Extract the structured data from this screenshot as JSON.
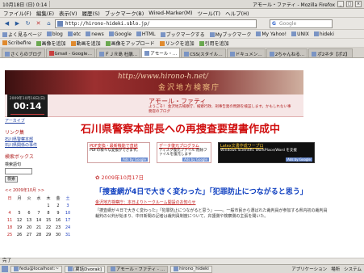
{
  "top_panel": {
    "date_time": "10月18日 (日)  0:14",
    "window_title": "アモール・ファティ - Mozilla Firefox"
  },
  "menu": [
    "ファイル(F)",
    "編集(E)",
    "表示(V)",
    "履歴(S)",
    "ブックマーク(B)",
    "Wired-Marker(M)",
    "ツール(T)",
    "ヘルプ(H)"
  ],
  "nav": {
    "url": "http://hirono-hideki.sblo.jp/",
    "search_placeholder": "Google"
  },
  "bookmarks": [
    "よく見るページ",
    "blog",
    "etc",
    "news",
    "Google",
    "HTML",
    "ブックマークする",
    "Myブックマーク",
    "My Yahoo!",
    "UNIX",
    "hideki"
  ],
  "toolbar2": [
    "Scribefire",
    "画像を追加",
    "動画を追加",
    "画像をアップロード",
    "リンクを追加",
    "引用を追加"
  ],
  "tabs": [
    {
      "label": "さくらのブログ",
      "active": false
    },
    {
      "label": "Gmail - Google…",
      "active": false
    },
    {
      "label": "ＦＪＲ島 杜鵑…",
      "active": false
    },
    {
      "label": "アモール・…",
      "active": true
    },
    {
      "label": "CSS(スタイル…",
      "active": false
    },
    {
      "label": "ドキュメン…",
      "active": false
    },
    {
      "label": "2ちゃんねる…",
      "active": false
    },
    {
      "label": "ポ2ネタ【ポ2】",
      "active": false
    }
  ],
  "banner": {
    "url_stamp": "http://www.hirono-h.net/",
    "slogan": "金沢地方検察庁",
    "blog_title": "アモール・ファティ",
    "blog_desc": "ようこそ！ 金沢地方検察庁、検察行政、刑事告発の問題を検証します。かもしれない事務官のブログ"
  },
  "clock": {
    "date": "2009年10月18日(日)",
    "time": "00:14"
  },
  "sidebar": {
    "archive_link": "アーカイブ",
    "links_head": "リンク集",
    "links": [
      "石川県警察本部",
      "石川県関係の事件"
    ],
    "search_head": "検索ボックス",
    "search_label": "検索語句",
    "search_button": "検索",
    "calendar_title": "<< 2009年10月 >>",
    "calendar_days": [
      "日",
      "月",
      "火",
      "水",
      "木",
      "金",
      "土"
    ],
    "calendar_rows": [
      [
        "",
        "",
        "",
        "",
        "1",
        "2",
        "3"
      ],
      [
        "4",
        "5",
        "6",
        "7",
        "8",
        "9",
        "10"
      ],
      [
        "11",
        "12",
        "13",
        "14",
        "15",
        "16",
        "17"
      ],
      [
        "18",
        "19",
        "20",
        "21",
        "22",
        "23",
        "24"
      ],
      [
        "25",
        "26",
        "27",
        "28",
        "29",
        "30",
        "31"
      ]
    ]
  },
  "main": {
    "headline": "石川県警察本部長への再捜査要望書作成中",
    "ads": [
      {
        "title": "PDF変換・最新機能で直結",
        "text": "PDFの様々な変換ができます。",
        "by": "Ads by Google"
      },
      {
        "title": "データ復元プログラム",
        "text": "ディスク復元ファイル 削除ファイルを復元します",
        "by": "Ads by Google"
      },
      {
        "title": "Latex文書作成ワープロ",
        "text": "Windows Scientific WorkPlace/Word を支援",
        "by": "Ads by Google"
      }
    ],
    "post_date": "2009年10月17日",
    "post_title": "「捜査網が4日で大きく変わった」「犯罪防止につながると思う」",
    "post_links": "金沢地方検察庁：本日よりトークルーム開設のお知らせ",
    "post_body": "「捜査網が４日で大きく変わった」「犯罪防止につながると思う」――。一般市民から選ばれた裁判員が参加する県内初の裁判員裁判の公判が始まり、中日新聞の記者は裁判員制度について、弁護側や検察側の主張を聞いた。"
  },
  "status": "完了",
  "taskbar": {
    "items": [
      {
        "label": "fedu@localhost:~",
        "active": false
      },
      {
        "label": "[翼話Dvorak]",
        "active": false
      },
      {
        "label": "アモール・ファティ - …",
        "active": true
      },
      {
        "label": "hirono_hideki",
        "active": false
      }
    ],
    "tray": [
      "アプリケーション",
      "場所",
      "システム"
    ]
  }
}
